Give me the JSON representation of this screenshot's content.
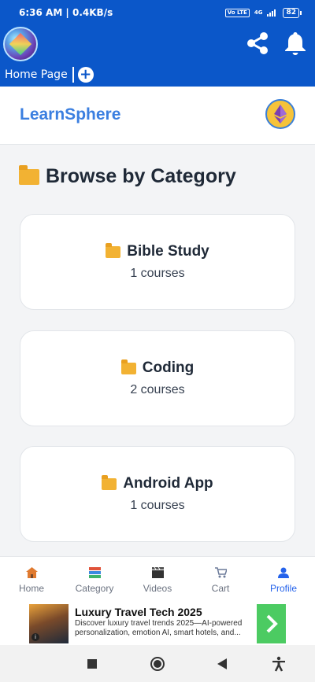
{
  "status_bar": {
    "time_speed": "6:36 AM | 0.4KB/s",
    "volte": "Vo LTE",
    "network": "4G",
    "battery": "82"
  },
  "app_header": {
    "tab_label": "Home Page",
    "add_tab_symbol": "+",
    "icons": [
      "app-logo",
      "share-icon",
      "bell-icon",
      "plus-icon"
    ]
  },
  "site": {
    "brand": "LearnSphere",
    "wallet_icon": "ethereum-icon"
  },
  "browse": {
    "title": "Browse by Category",
    "title_icon": "folder-open-icon",
    "categories": [
      {
        "name": "Bible Study",
        "count": "1 courses",
        "icon": "folder-icon"
      },
      {
        "name": "Coding",
        "count": "2 courses",
        "icon": "folder-icon"
      },
      {
        "name": "Android App",
        "count": "1 courses",
        "icon": "folder-icon"
      }
    ]
  },
  "bottom_nav": {
    "items": [
      {
        "label": "Home",
        "icon": "house-icon"
      },
      {
        "label": "Category",
        "icon": "books-icon"
      },
      {
        "label": "Videos",
        "icon": "clapper-icon"
      },
      {
        "label": "Cart",
        "icon": "cart-icon"
      },
      {
        "label": "Profile",
        "icon": "person-icon"
      }
    ],
    "active_index": 4
  },
  "ad": {
    "title": "Luxury Travel Tech 2025",
    "description": "Discover luxury travel trends 2025—AI-powered personalization, emotion AI, smart hotels, and...",
    "info_symbol": "i"
  },
  "colors": {
    "app_bar": "#0b57c9",
    "brand": "#3b7fe0",
    "active_nav": "#2563eb",
    "folder": "#f2b233",
    "ad_cta": "#4ccb62"
  }
}
